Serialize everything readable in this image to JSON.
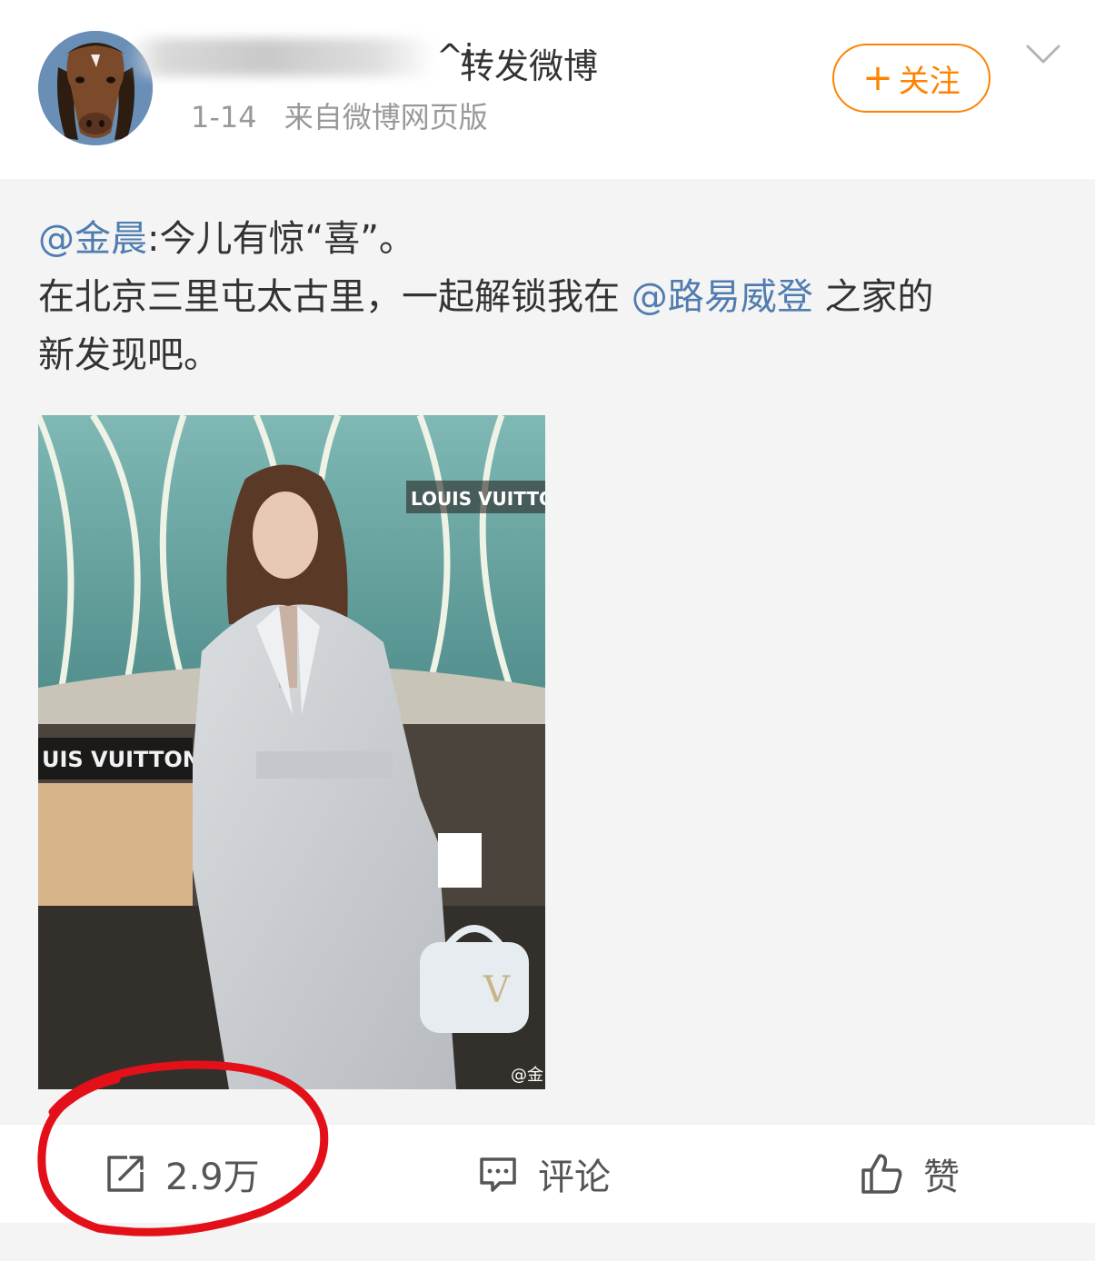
{
  "post": {
    "username_tail": "^i",
    "repost_label": "转发微博",
    "date": "1-14",
    "source": "来自微博网页版",
    "follow_button": "关注",
    "follow_plus": "+"
  },
  "original": {
    "author_mention": "@金晨",
    "line1_rest": ":今儿有惊“喜”。",
    "line2_before": "在北京三里屯太古里，一起解锁我在 ",
    "brand_mention": "@路易威登",
    "line2_after": " 之家的",
    "line3": "新发现吧。",
    "image": {
      "sign_top": "LOUIS VUITTON",
      "sign_left": "UIS VUITTON",
      "watermark": "@金"
    }
  },
  "actions": {
    "repost_count": "2.9万",
    "comment_label": "评论",
    "like_label": "赞"
  },
  "colors": {
    "accent_orange": "#ff8200",
    "mention_blue": "#507daf",
    "annotation_red": "#e3101a"
  }
}
